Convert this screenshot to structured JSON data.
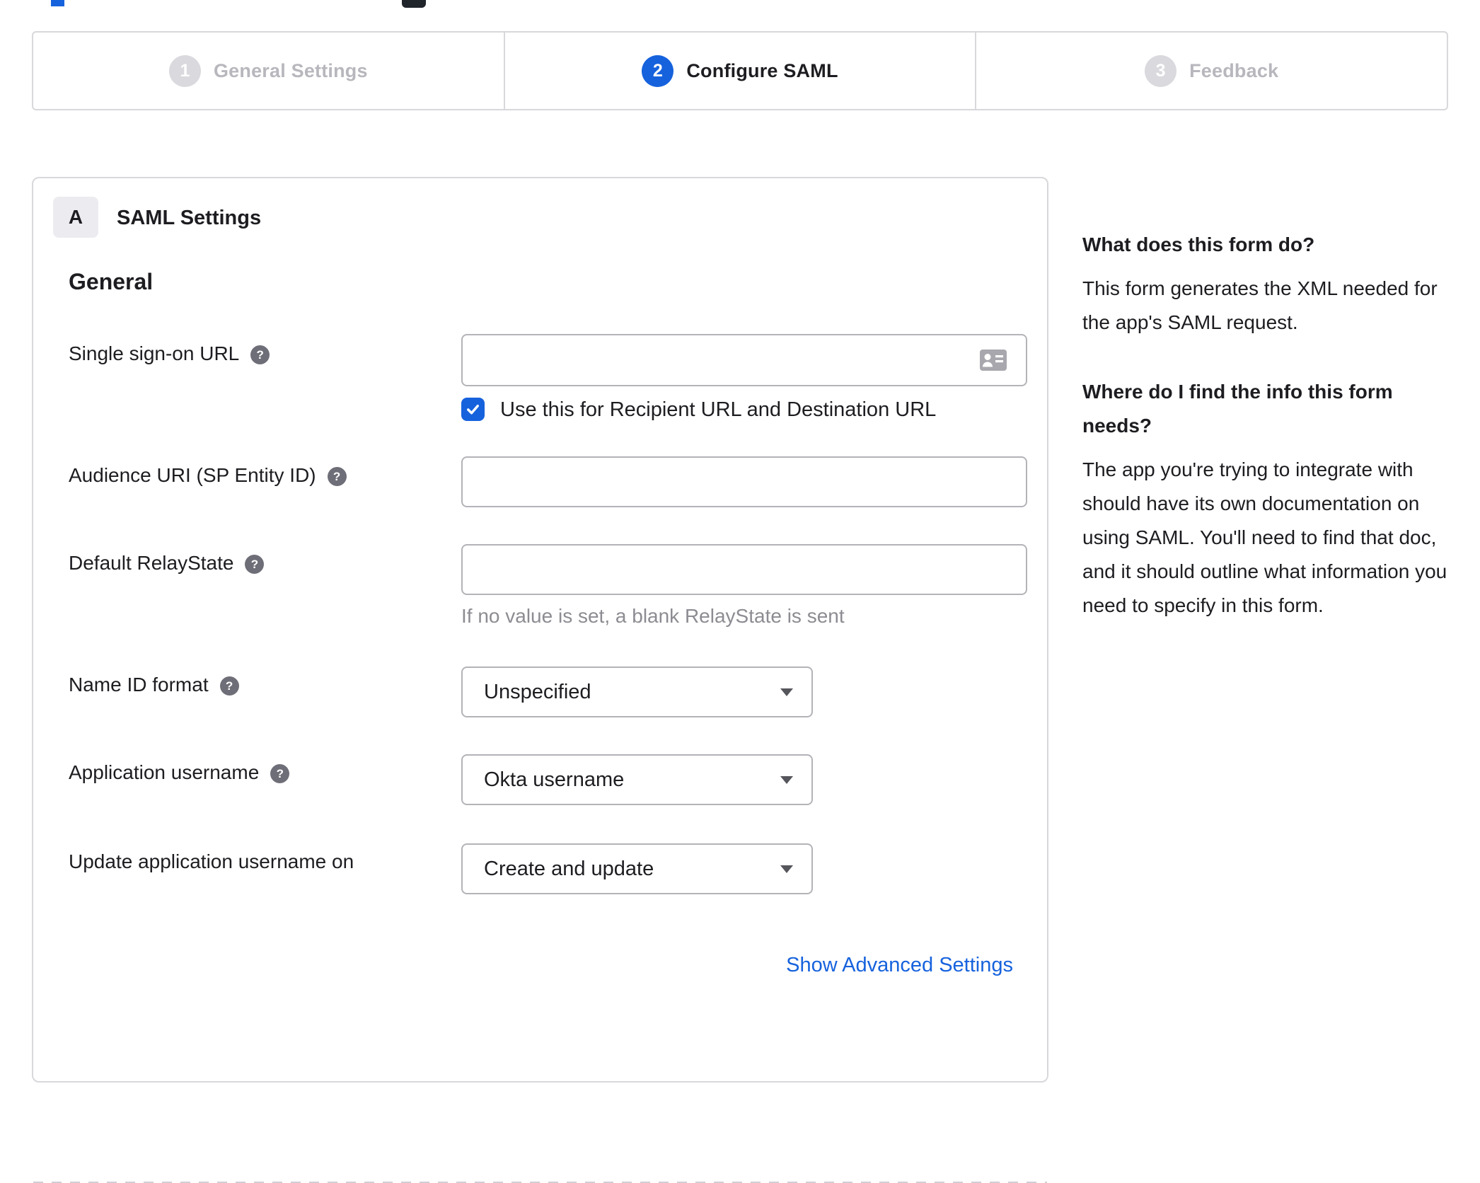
{
  "colors": {
    "accent_blue": "#1662dd",
    "text_dark": "#1d1d21",
    "hint_gray": "#8c8c92",
    "inactive_gray": "#b7b7bd"
  },
  "icons": {
    "help": "?"
  },
  "stepper": {
    "steps": [
      {
        "number": "1",
        "label": "General Settings",
        "active": false
      },
      {
        "number": "2",
        "label": "Configure SAML",
        "active": true
      },
      {
        "number": "3",
        "label": "Feedback",
        "active": false
      }
    ]
  },
  "panel": {
    "badge": "A",
    "title": "SAML Settings",
    "section_heading": "General",
    "fields": {
      "sso": {
        "label": "Single sign-on URL",
        "value": "",
        "checkbox_label": "Use this for Recipient URL and Destination URL",
        "checkbox_checked": true
      },
      "audience": {
        "label": "Audience URI (SP Entity ID)",
        "value": ""
      },
      "relay": {
        "label": "Default RelayState",
        "value": "",
        "hint": "If no value is set, a blank RelayState is sent"
      },
      "name_id": {
        "label": "Name ID format",
        "value": "Unspecified"
      },
      "app_username": {
        "label": "Application username",
        "value": "Okta username"
      },
      "update_username": {
        "label": "Update application username on",
        "value": "Create and update"
      }
    },
    "advanced_link": "Show Advanced Settings"
  },
  "sidebar": {
    "sections": [
      {
        "heading": "What does this form do?",
        "body": "This form generates the XML needed for the app's SAML request."
      },
      {
        "heading": "Where do I find the info this form needs?",
        "body": "The app you're trying to integrate with should have its own documentation on using SAML. You'll need to find that doc, and it should outline what information you need to specify in this form."
      }
    ]
  }
}
